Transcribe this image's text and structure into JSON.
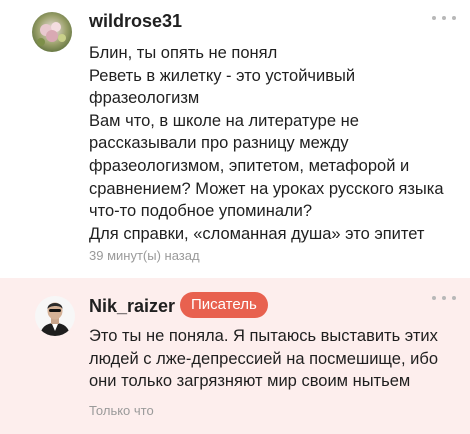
{
  "comments": [
    {
      "username": "wildrose31",
      "text": "Блин, ты опять не понял\nРеветь в жилетку - это устойчивый фразеологизм\nВам что, в школе на литературе не рассказывали про разницу между фразеологизмом, эпитетом, метафорой и сравнением? Может на уроках русского языка что-то подобное упоминали?\nДля справки, «сломанная душа» это эпитет",
      "time": "39 минут(ы) назад",
      "avatar_icon": "flower-photo-avatar",
      "more_icon": "more-dots-icon"
    },
    {
      "username": "Nik_raizer",
      "badge": "Писатель",
      "text": "Это ты не поняла. Я пытаюсь выставить этих людей с лже-депрессией на посмешище, ибо они только загрязняют мир своим нытьем",
      "time": "Только что",
      "avatar_icon": "man-in-suit-avatar",
      "more_icon": "more-dots-icon"
    }
  ],
  "colors": {
    "highlight_background": "#fdeeed",
    "badge_background": "#e8614f",
    "time_text": "#9a9a9a",
    "more_dots": "#b8b8b8"
  }
}
